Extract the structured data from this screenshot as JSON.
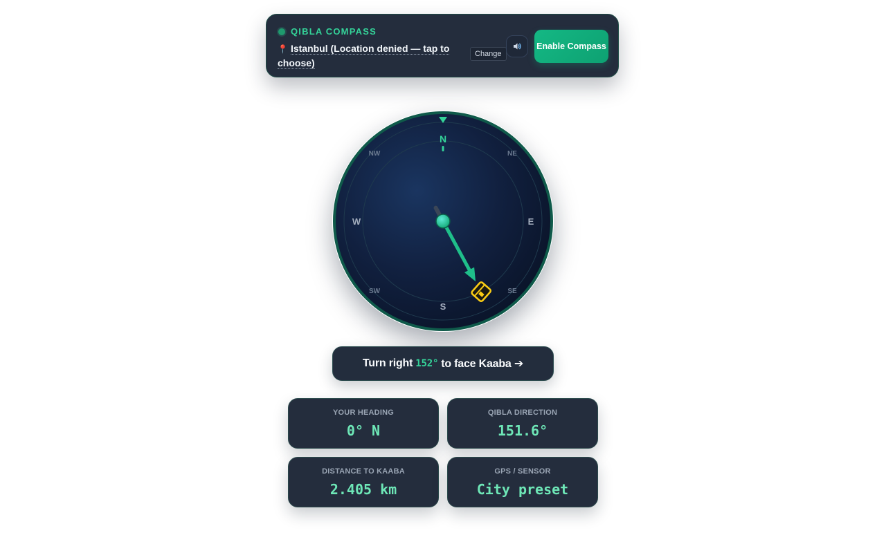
{
  "header": {
    "brand": "QIBLA COMPASS",
    "location_icon": "pin-icon",
    "location_text": "Istanbul (Location denied — tap to choose)",
    "change_label": "Change",
    "sound_icon": "speaker-icon",
    "enable_label": "Enable Compass"
  },
  "compass": {
    "labels": {
      "N": "N",
      "S": "S",
      "E": "E",
      "W": "W",
      "NE": "NE",
      "NW": "NW",
      "SE": "SE",
      "SW": "SW"
    },
    "heading_deg": 0,
    "qibla_deg": 151.6,
    "kaaba_icon": "kaaba-icon",
    "colors": {
      "accent": "#34d399",
      "kaaba": "#facc15",
      "dial": "#0f1a33",
      "rim": "#115e4f"
    }
  },
  "instruction": {
    "prefix": "Turn right",
    "degrees": "152°",
    "suffix": "to face Kaaba ➔"
  },
  "stats": {
    "heading": {
      "label": "YOUR HEADING",
      "value": "0° N"
    },
    "qibla": {
      "label": "QIBLA DIRECTION",
      "value": "151.6°"
    },
    "distance": {
      "label": "DISTANCE TO KAABA",
      "value": "2.405 km"
    },
    "gps": {
      "label": "GPS / SENSOR",
      "value": "City preset"
    }
  }
}
